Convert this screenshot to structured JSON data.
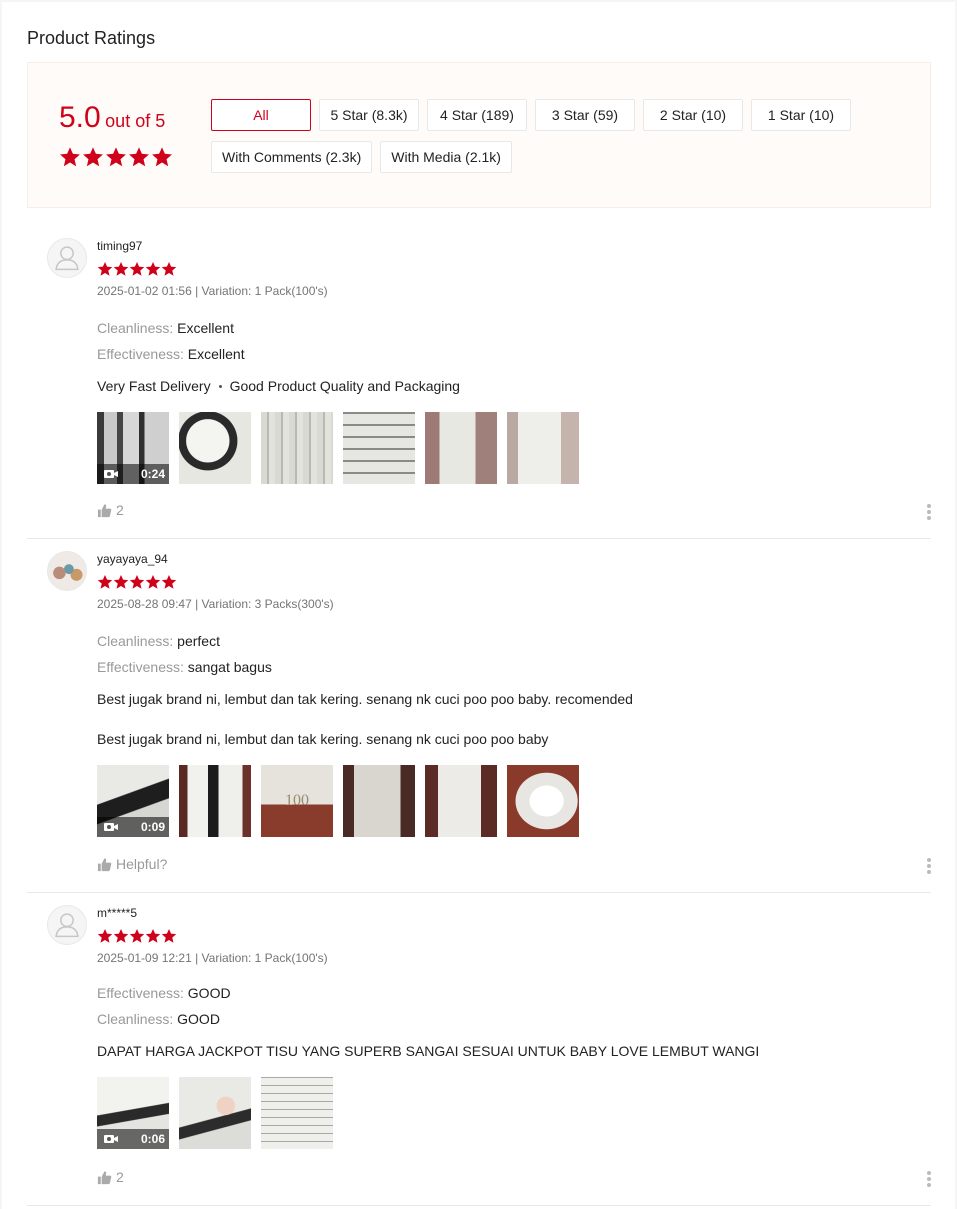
{
  "section_title": "Product Ratings",
  "overview": {
    "score": "5.0",
    "out_of": "out of 5",
    "stars": 5,
    "accent_color": "#d0011b",
    "filters": [
      {
        "label": "All",
        "active": true
      },
      {
        "label": "5 Star (8.3k)"
      },
      {
        "label": "4 Star (189)"
      },
      {
        "label": "3 Star (59)"
      },
      {
        "label": "2 Star (10)"
      },
      {
        "label": "1 Star (10)"
      },
      {
        "label": "With Comments (2.3k)"
      },
      {
        "label": "With Media (2.1k)"
      }
    ]
  },
  "reviews": [
    {
      "username": "timing97",
      "rating": 5,
      "meta": "2025-01-02 01:56 | Variation: 1 Pack(100's)",
      "attributes": [
        {
          "key": "Cleanliness:",
          "value": "Excellent"
        },
        {
          "key": "Effectiveness:",
          "value": "Excellent"
        }
      ],
      "comment_tags": [
        "Very Fast Delivery",
        "Good Product Quality and Packaging"
      ],
      "video_duration": "0:24",
      "helpful": "2"
    },
    {
      "username": "yayayaya_94",
      "rating": 5,
      "meta": "2025-08-28 09:47 | Variation: 3 Packs(300's)",
      "attributes": [
        {
          "key": "Cleanliness:",
          "value": "perfect"
        },
        {
          "key": "Effectiveness:",
          "value": "sangat bagus"
        }
      ],
      "comment_line1": "Best jugak brand ni, lembut dan tak kering. senang nk cuci poo poo baby. recomended",
      "comment_line2": "Best jugak brand ni, lembut dan tak kering. senang nk cuci poo poo baby",
      "video_duration": "0:09",
      "thumb_text": "100",
      "helpful": "Helpful?"
    },
    {
      "username": "m*****5",
      "rating": 5,
      "meta": "2025-01-09 12:21 | Variation: 1 Pack(100's)",
      "attributes": [
        {
          "key": "Effectiveness:",
          "value": "GOOD"
        },
        {
          "key": "Cleanliness:",
          "value": "GOOD"
        }
      ],
      "comment": "DAPAT HARGA JACKPOT TISU YANG SUPERB SANGAI SESUAI UNTUK BABY LOVE LEMBUT WANGI",
      "video_duration": "0:06",
      "helpful": "2"
    }
  ]
}
